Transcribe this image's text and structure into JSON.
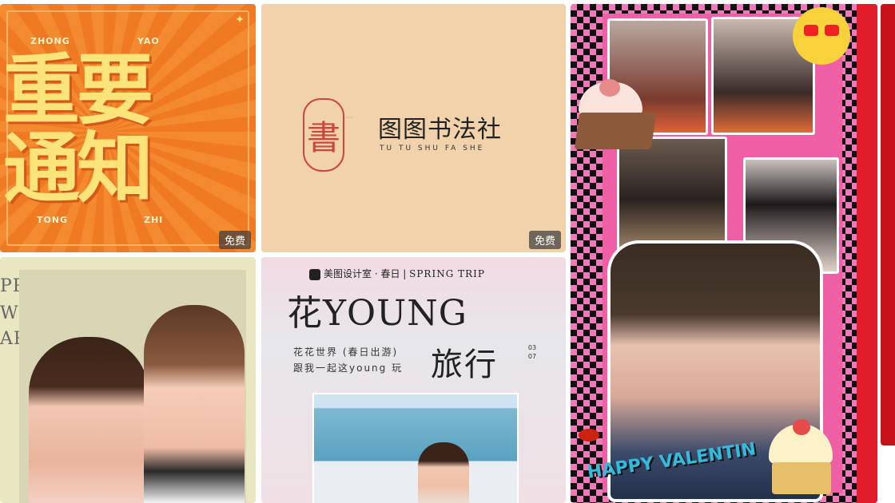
{
  "cards": {
    "notice": {
      "pinyin_top_left": "ZHONG",
      "pinyin_top_right": "YAO",
      "line1": "重要",
      "line2": "通知",
      "pinyin_bottom_left": "TONG",
      "pinyin_bottom_right": "ZHI",
      "badge": "免费"
    },
    "calligraphy": {
      "seal_char": "書",
      "name": "图图书法社",
      "pinyin": "TU TU SHU FA SHE",
      "badge": "免费"
    },
    "new_year": {
      "line1": "PPY",
      "line2": "W",
      "line3": "AR"
    },
    "spring_trip": {
      "brand": "美图设计室 · 春日 |",
      "brand_en": "SPRING TRIP",
      "title": "花YOUNG",
      "line1": "花花世界 (春日出游)",
      "line2": "跟我一起这young 玩",
      "travel": "旅行",
      "date": "03 07"
    },
    "collage": {
      "sticker_text": "HAPPY VALENTIN"
    }
  },
  "colors": {
    "orange": "#f07a22",
    "yellow": "#fde47a",
    "beige": "#f1d2aa",
    "seal_red": "#c9473c",
    "pink": "#ef5fa5",
    "red": "#c8111b"
  }
}
